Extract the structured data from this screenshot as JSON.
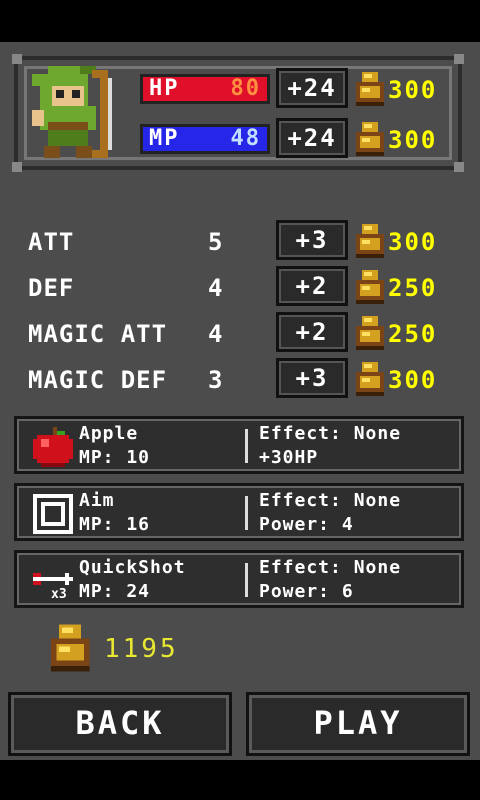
{
  "hero": {
    "hp_label": "HP",
    "hp_value": "80",
    "hp_upgrade": "+24",
    "hp_cost": "300",
    "mp_label": "MP",
    "mp_value": "48",
    "mp_upgrade": "+24",
    "mp_cost": "300"
  },
  "stats": [
    {
      "name": "ATT",
      "value": "5",
      "upgrade": "+3",
      "cost": "300"
    },
    {
      "name": "DEF",
      "value": "4",
      "upgrade": "+2",
      "cost": "250"
    },
    {
      "name": "MAGIC ATT",
      "value": "4",
      "upgrade": "+2",
      "cost": "250"
    },
    {
      "name": "MAGIC DEF",
      "value": "3",
      "upgrade": "+3",
      "cost": "300"
    }
  ],
  "skills": [
    {
      "name": "Apple",
      "mp": "MP: 10",
      "effect": "Effect: None",
      "detail": "+30HP",
      "icon": "apple-icon"
    },
    {
      "name": "Aim",
      "mp": "MP: 16",
      "effect": "Effect: None",
      "detail": "Power: 4",
      "icon": "aim-icon"
    },
    {
      "name": "QuickShot",
      "mp": "MP: 24",
      "effect": "Effect: None",
      "detail": "Power: 6",
      "icon": "arrow-icon",
      "badge": "x3"
    }
  ],
  "gold": "1195",
  "buttons": {
    "back": "BACK",
    "play": "PLAY"
  },
  "colors": {
    "hp": "#e0102a",
    "mp": "#2626e8",
    "cost": "#ffff00",
    "gold_text": "#e8e832"
  }
}
